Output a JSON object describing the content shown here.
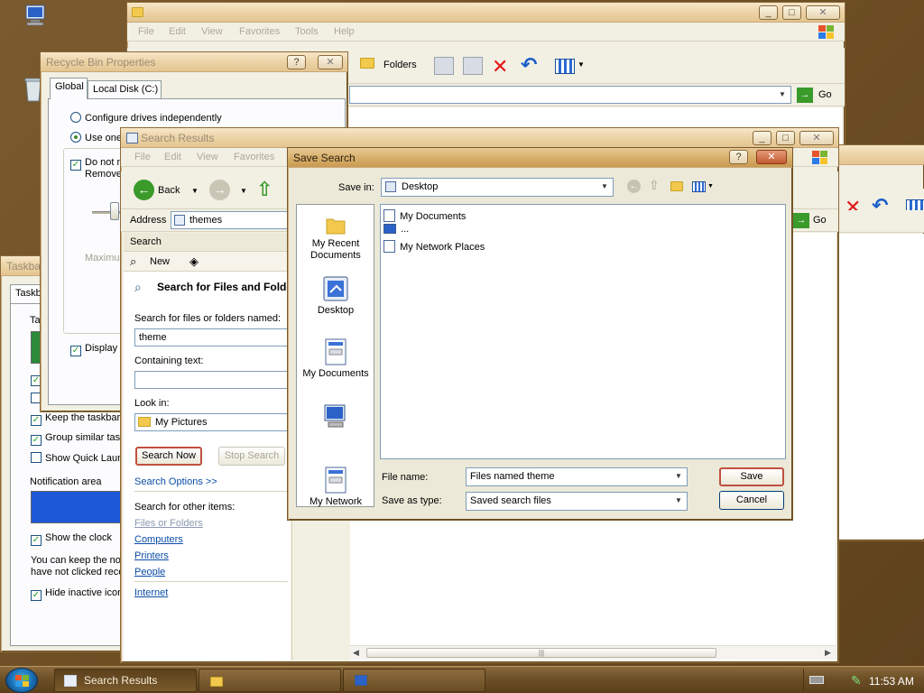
{
  "desktop": {
    "icons": [
      "computer-icon",
      "recycle-bin-icon",
      "drive-icon"
    ]
  },
  "explorer_back": {
    "menu": [
      "File",
      "Edit",
      "View",
      "Favorites",
      "Tools",
      "Help"
    ],
    "folders_label": "Folders",
    "go_label": "Go"
  },
  "explorer_mid": {
    "go_label": "Go"
  },
  "recycle_bin": {
    "title": "Recycle Bin Properties",
    "tabs": [
      "Global",
      "Local Disk (C:)"
    ],
    "radio_independent": "Configure drives independently",
    "radio_one": "Use one",
    "chk_donot": "Do not m",
    "chk_remove": "Remove",
    "maximum_label": "Maximum",
    "chk_display": "Display d"
  },
  "taskbar_props": {
    "title": "Taskba",
    "tab": "Taskb",
    "group1_label": "Ta",
    "keep_taskbar": "Keep the taskbar",
    "group_similar": "Group similar task",
    "show_quick": "Show Quick Laun",
    "notification_area": "Notification area",
    "show_clock": "Show the clock",
    "help_line1": "You can keep the no",
    "help_line2": "have not clicked rece",
    "hide_inactive": "Hide inactive icon"
  },
  "search_results": {
    "title": "Search Results",
    "menu": [
      "File",
      "Edit",
      "View",
      "Favorites"
    ],
    "back_label": "Back",
    "address_label": "Address",
    "address_value": "themes",
    "search_header": "Search",
    "new_label": "New",
    "heading": "Search for Files and Folde",
    "named_label": "Search for files or folders named:",
    "named_value": "theme",
    "containing_label": "Containing text:",
    "containing_value": "",
    "lookin_label": "Look in:",
    "lookin_value": "My Pictures",
    "search_now": "Search Now",
    "stop_search": "Stop Search",
    "search_options": "Search Options >>",
    "other_items_label": "Search for other items:",
    "other_items": [
      "Files or Folders",
      "Computers",
      "Printers",
      "People"
    ],
    "internet": "Internet",
    "go_label": "Go"
  },
  "save_search": {
    "title": "Save Search",
    "save_in_label": "Save in:",
    "save_in_value": "Desktop",
    "places": [
      "My Recent Documents",
      "Desktop",
      "My Documents",
      "",
      "My Network"
    ],
    "files": [
      "My Documents",
      "...",
      "My Network Places"
    ],
    "filename_label": "File name:",
    "filename_value": "Files named theme",
    "type_label": "Save as type:",
    "type_value": "Saved search files",
    "save_label": "Save",
    "cancel_label": "Cancel"
  },
  "taskbar": {
    "items": [
      "Search Results",
      "",
      ""
    ],
    "clock": "11:53 AM"
  }
}
